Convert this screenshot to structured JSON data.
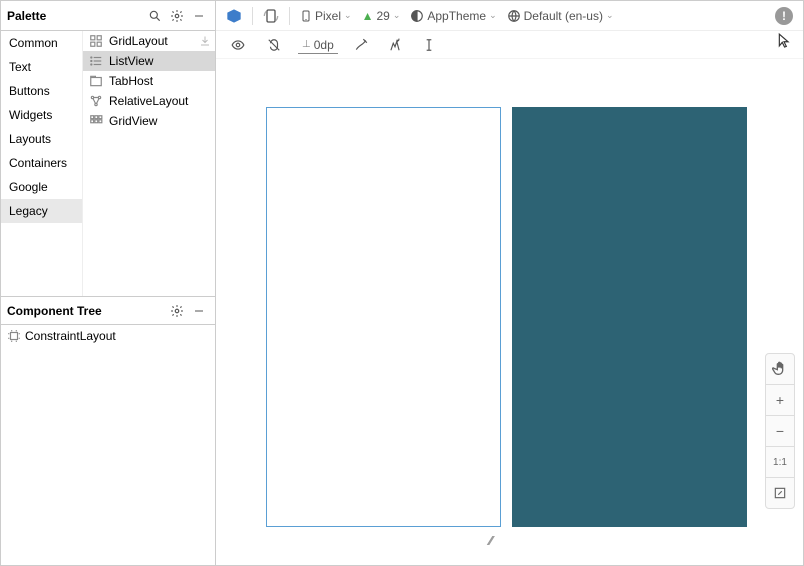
{
  "palette": {
    "title": "Palette",
    "categories": [
      "Common",
      "Text",
      "Buttons",
      "Widgets",
      "Layouts",
      "Containers",
      "Google",
      "Legacy"
    ],
    "selected_category": "Legacy",
    "items": [
      {
        "icon": "grid",
        "label": "GridLayout"
      },
      {
        "icon": "list",
        "label": "ListView"
      },
      {
        "icon": "tab",
        "label": "TabHost"
      },
      {
        "icon": "rel",
        "label": "RelativeLayout"
      },
      {
        "icon": "gridview",
        "label": "GridView"
      }
    ],
    "selected_item": "ListView"
  },
  "component_tree": {
    "title": "Component Tree",
    "root": "ConstraintLayout"
  },
  "toolbar": {
    "device": "Pixel",
    "api": "29",
    "theme": "AppTheme",
    "locale": "Default (en-us)",
    "viewport_label": "0dp"
  },
  "zoom": {
    "plus": "+",
    "minus": "−",
    "ratio": "1:1"
  }
}
